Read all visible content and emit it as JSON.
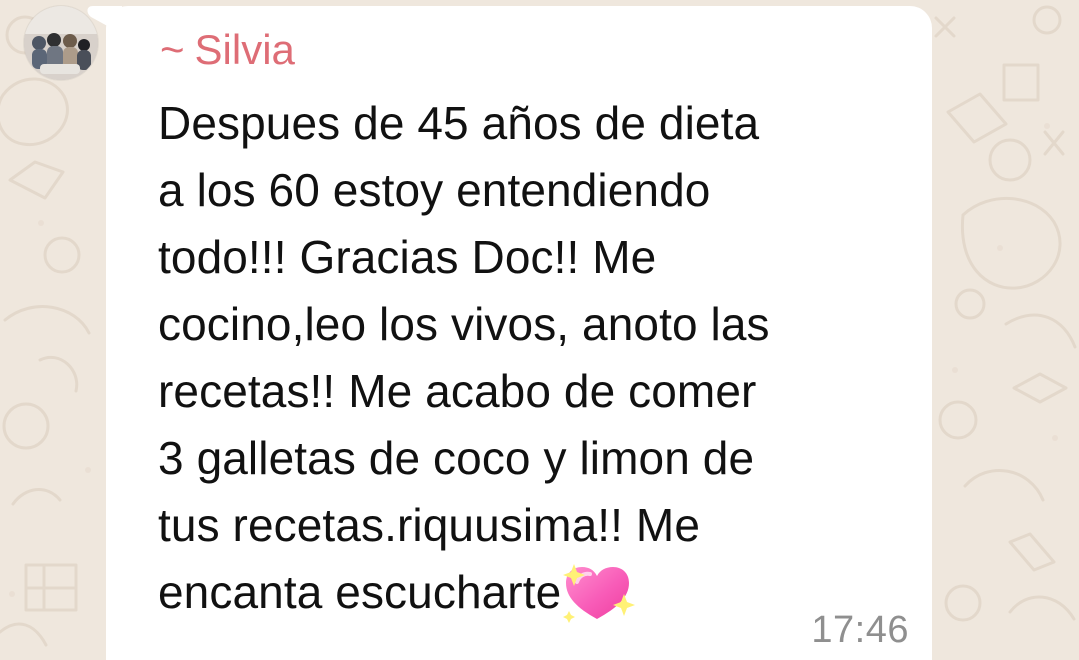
{
  "chat": {
    "sender_prefix": "~",
    "sender_name": "Silvia",
    "message_lines": [
      "Despues de 45 años de dieta",
      "a los 60 estoy entendiendo",
      "todo!!! Gracias Doc!! Me",
      "cocino,leo los vivos, anoto las",
      "recetas!! Me acabo de comer",
      "3 galletas de coco y limon de",
      "tus recetas.riquusima!! Me",
      "encanta escucharte"
    ],
    "emoji": "sparkling-heart-icon",
    "time": "17:46"
  },
  "colors": {
    "wallpaper": "#efe7dd",
    "bubble": "#ffffff",
    "sender": "#de6d76",
    "message_text": "#111111",
    "time": "#8f8f8f"
  },
  "icons": {
    "avatar": "profile-photo-avatar",
    "wallpaper": "chat-doodle-pattern"
  }
}
